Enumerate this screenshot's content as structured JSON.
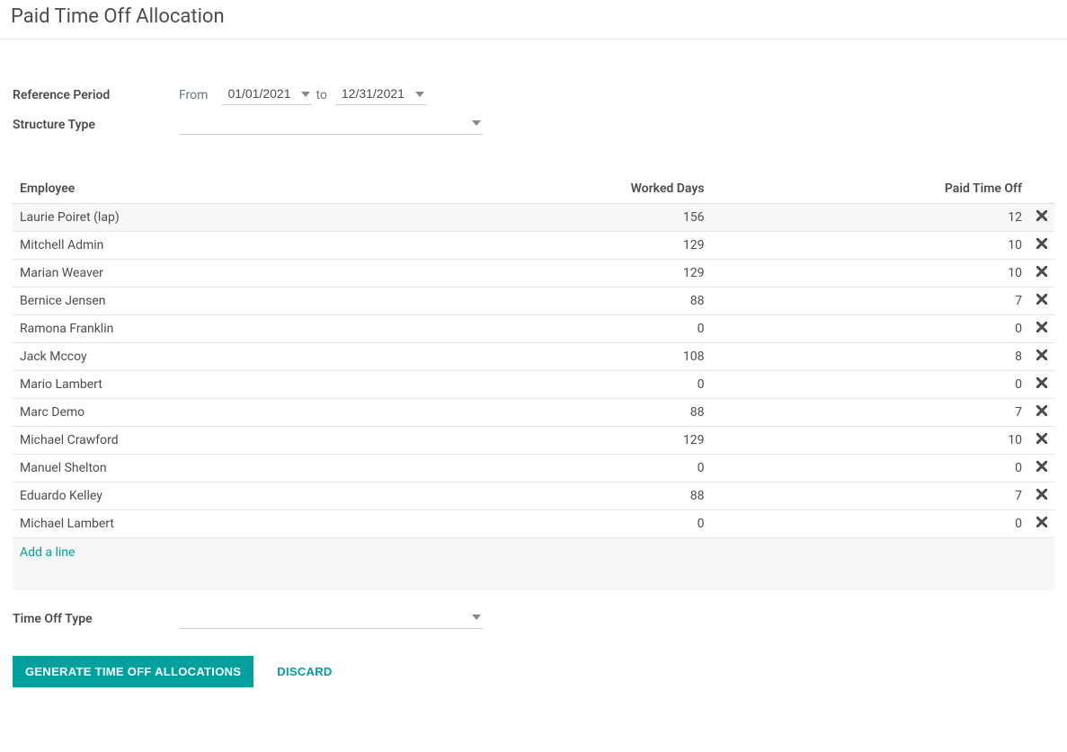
{
  "title": "Paid Time Off Allocation",
  "form": {
    "reference_period_label": "Reference Period",
    "from_label": "From",
    "date_from": "01/01/2021",
    "to_label": "to",
    "date_to": "12/31/2021",
    "structure_type_label": "Structure Type",
    "structure_type_value": ""
  },
  "table": {
    "headers": {
      "employee": "Employee",
      "worked_days": "Worked Days",
      "pto": "Paid Time Off"
    },
    "rows": [
      {
        "employee": "Laurie Poiret (lap)",
        "worked_days": "156",
        "pto": "12"
      },
      {
        "employee": "Mitchell Admin",
        "worked_days": "129",
        "pto": "10"
      },
      {
        "employee": "Marian Weaver",
        "worked_days": "129",
        "pto": "10"
      },
      {
        "employee": "Bernice Jensen",
        "worked_days": "88",
        "pto": "7"
      },
      {
        "employee": "Ramona Franklin",
        "worked_days": "0",
        "pto": "0"
      },
      {
        "employee": "Jack Mccoy",
        "worked_days": "108",
        "pto": "8"
      },
      {
        "employee": "Mario Lambert",
        "worked_days": "0",
        "pto": "0"
      },
      {
        "employee": "Marc Demo",
        "worked_days": "88",
        "pto": "7"
      },
      {
        "employee": "Michael Crawford",
        "worked_days": "129",
        "pto": "10"
      },
      {
        "employee": "Manuel Shelton",
        "worked_days": "0",
        "pto": "0"
      },
      {
        "employee": "Eduardo Kelley",
        "worked_days": "88",
        "pto": "7"
      },
      {
        "employee": "Michael Lambert",
        "worked_days": "0",
        "pto": "0"
      }
    ],
    "add_line_label": "Add a line"
  },
  "footer": {
    "time_off_type_label": "Time Off Type",
    "time_off_type_value": "",
    "generate_label": "Generate Time Off Allocations",
    "discard_label": "Discard"
  }
}
